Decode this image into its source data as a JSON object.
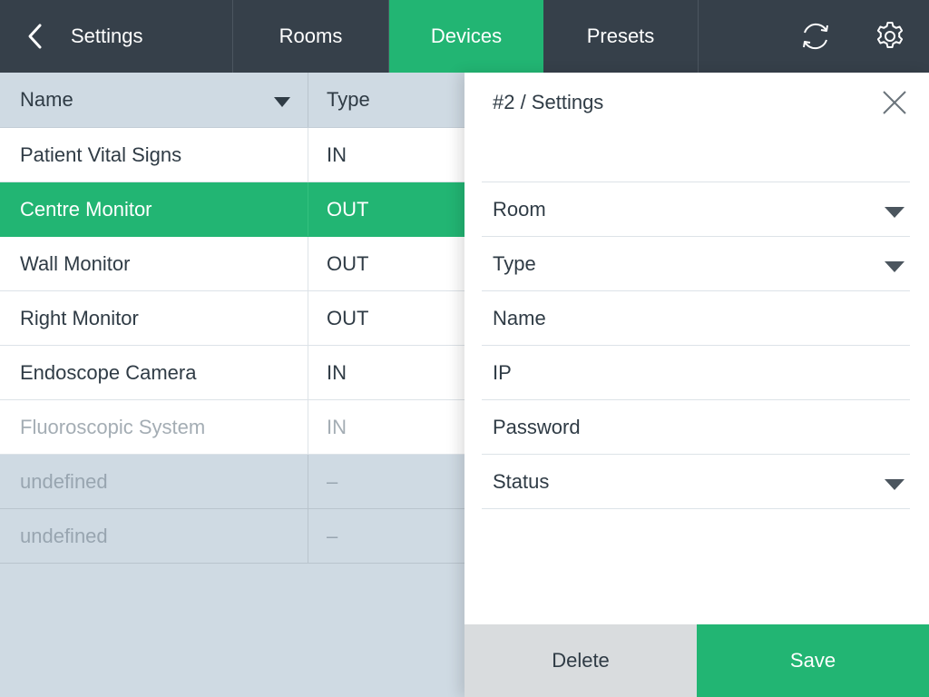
{
  "header": {
    "back_label": "Settings",
    "tabs": [
      {
        "label": "Rooms",
        "active": false
      },
      {
        "label": "Devices",
        "active": true
      },
      {
        "label": "Presets",
        "active": false
      }
    ],
    "icons": [
      "refresh-icon",
      "gear-icon"
    ]
  },
  "colors": {
    "topbar": "#36404a",
    "accent": "#22b573",
    "background": "#cfdae3",
    "delete_button": "#d9dcde"
  },
  "table": {
    "columns": [
      "Name",
      "Type"
    ],
    "rows": [
      {
        "name": "Patient Vital Signs",
        "type": "IN",
        "state": "normal"
      },
      {
        "name": "Centre Monitor",
        "type": "OUT",
        "state": "selected"
      },
      {
        "name": "Wall Monitor",
        "type": "OUT",
        "state": "normal"
      },
      {
        "name": "Right Monitor",
        "type": "OUT",
        "state": "normal"
      },
      {
        "name": "Endoscope Camera",
        "type": "IN",
        "state": "normal"
      },
      {
        "name": "Fluoroscopic System",
        "type": "IN",
        "state": "disabled"
      },
      {
        "name": "undefined",
        "type": "–",
        "state": "empty"
      },
      {
        "name": "undefined",
        "type": "–",
        "state": "empty"
      }
    ]
  },
  "panel": {
    "title": "#2 / Settings",
    "fields": [
      {
        "label": "Room",
        "dropdown": true
      },
      {
        "label": "Type",
        "dropdown": true
      },
      {
        "label": "Name",
        "dropdown": false
      },
      {
        "label": "IP",
        "dropdown": false
      },
      {
        "label": "Password",
        "dropdown": false
      },
      {
        "label": "Status",
        "dropdown": true
      }
    ],
    "delete_label": "Delete",
    "save_label": "Save"
  }
}
